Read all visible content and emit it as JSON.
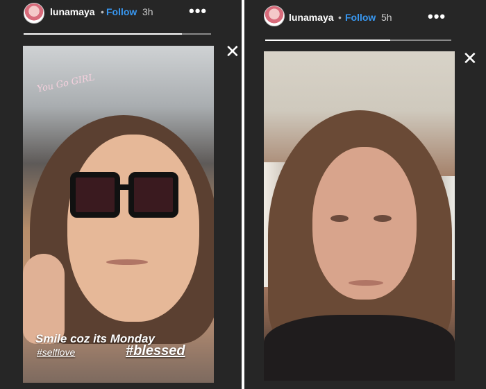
{
  "stories": [
    {
      "username": "lunamaya",
      "separator": "•",
      "follow_label": "Follow",
      "time": "3h",
      "more_icon": "more-options-icon",
      "close_icon": "close-icon",
      "sticker_text": "You Go GIRL",
      "caption": "Smile coz its Monday",
      "hashtag_small": "#selflove",
      "hashtag_big": "#blessed",
      "progress": {
        "segments": 2,
        "active": 1
      }
    },
    {
      "username": "lunamaya",
      "separator": "•",
      "follow_label": "Follow",
      "time": "5h",
      "more_icon": "more-options-icon",
      "close_icon": "close-icon",
      "progress": {
        "segments": 2,
        "active": 1
      }
    }
  ],
  "colors": {
    "background": "#262626",
    "follow": "#3897f0",
    "text": "#ffffff"
  }
}
